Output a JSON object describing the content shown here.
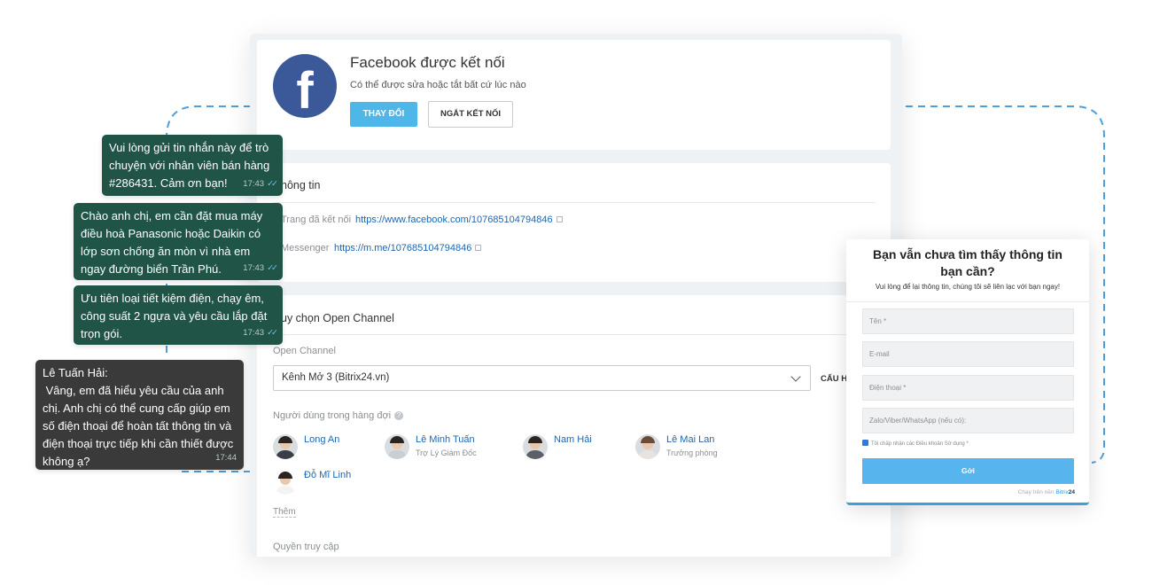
{
  "facebook": {
    "logo_letter": "f",
    "title": "Facebook được kết nối",
    "subtitle": "Có thể được sửa hoặc tắt bất cứ lúc nào",
    "change_button": "THAY ĐỔI",
    "disconnect_button": "NGẮT KẾT NỐI",
    "brand_color": "#3b5998"
  },
  "info": {
    "title": "hông tin",
    "page_label": "Trang đã kết nối",
    "page_url": "https://www.facebook.com/107685104794846",
    "messenger_label": "Messenger",
    "messenger_url": "https://m.me/107685104794846"
  },
  "open_channel": {
    "title": "uy chọn Open Channel",
    "field_label": "Open Channel",
    "selected": "Kênh Mở 3 (Bitrix24.vn)",
    "configure_button": "CẤU H",
    "queue_label": "Người dùng trong hàng đợi",
    "users": [
      {
        "name": "Long An",
        "role": ""
      },
      {
        "name": "Lê Minh Tuấn",
        "role": "Trợ Lý Giám Đốc"
      },
      {
        "name": "Nam Hải",
        "role": ""
      },
      {
        "name": "Lê Mai Lan",
        "role": "Trưởng phòng"
      },
      {
        "name": "Đỗ Mĩ Linh",
        "role": ""
      }
    ],
    "more_link": "Thêm",
    "access_label": "Quyền truy cập"
  },
  "chat": {
    "messages": [
      {
        "text": "Vui lòng gửi tin nhắn này để trò\nchuyện với nhân viên bán hàng\n#286431. Cảm ơn bạn!",
        "time": "17:43",
        "read": true
      },
      {
        "text": "Chào anh chị, em cần đặt mua máy\nđiều hoà Panasonic hoặc Daikin có\nlớp sơn chống ăn mòn vì nhà em\nngay đường biển Trần Phú.",
        "time": "17:43",
        "read": true
      },
      {
        "text": "Ưu tiên loại tiết kiệm điện, chạy êm,\ncông suất 2 ngựa và yêu cầu lắp đặt\ntrọn gói.",
        "time": "17:43",
        "read": true
      },
      {
        "text": "Lê Tuấn Hải:\n Vâng, em đã hiểu yêu cầu của anh\nchị. Anh chị có thể cung cấp giúp em\nsố điện thoại để hoàn tất thông tin và\nđiện thoại trực tiếp khi cần thiết được\nkhông ạ?",
        "time": "17:44",
        "read": false
      }
    ],
    "bubble_color": "#1f5446",
    "reply_bubble_color": "#3a3a3a"
  },
  "form": {
    "title": "Bạn vẫn chưa tìm thấy thông tin bạn cần?",
    "subtitle": "Vui lòng để lại thông tin, chúng tôi sẽ liên lạc với bạn ngay!",
    "fields": [
      "Tên *",
      "E-mail",
      "Điện thoại *",
      "Zalo/Viber/WhatsApp (nếu có):"
    ],
    "consent": "Tôi chấp nhận các Điều khoản Sử dụng *",
    "submit": "Gởi",
    "powered_prefix": "Chạy trên nền",
    "powered_brand": "Bitrix",
    "powered_num": "24",
    "accent_color": "#58b4ec"
  }
}
